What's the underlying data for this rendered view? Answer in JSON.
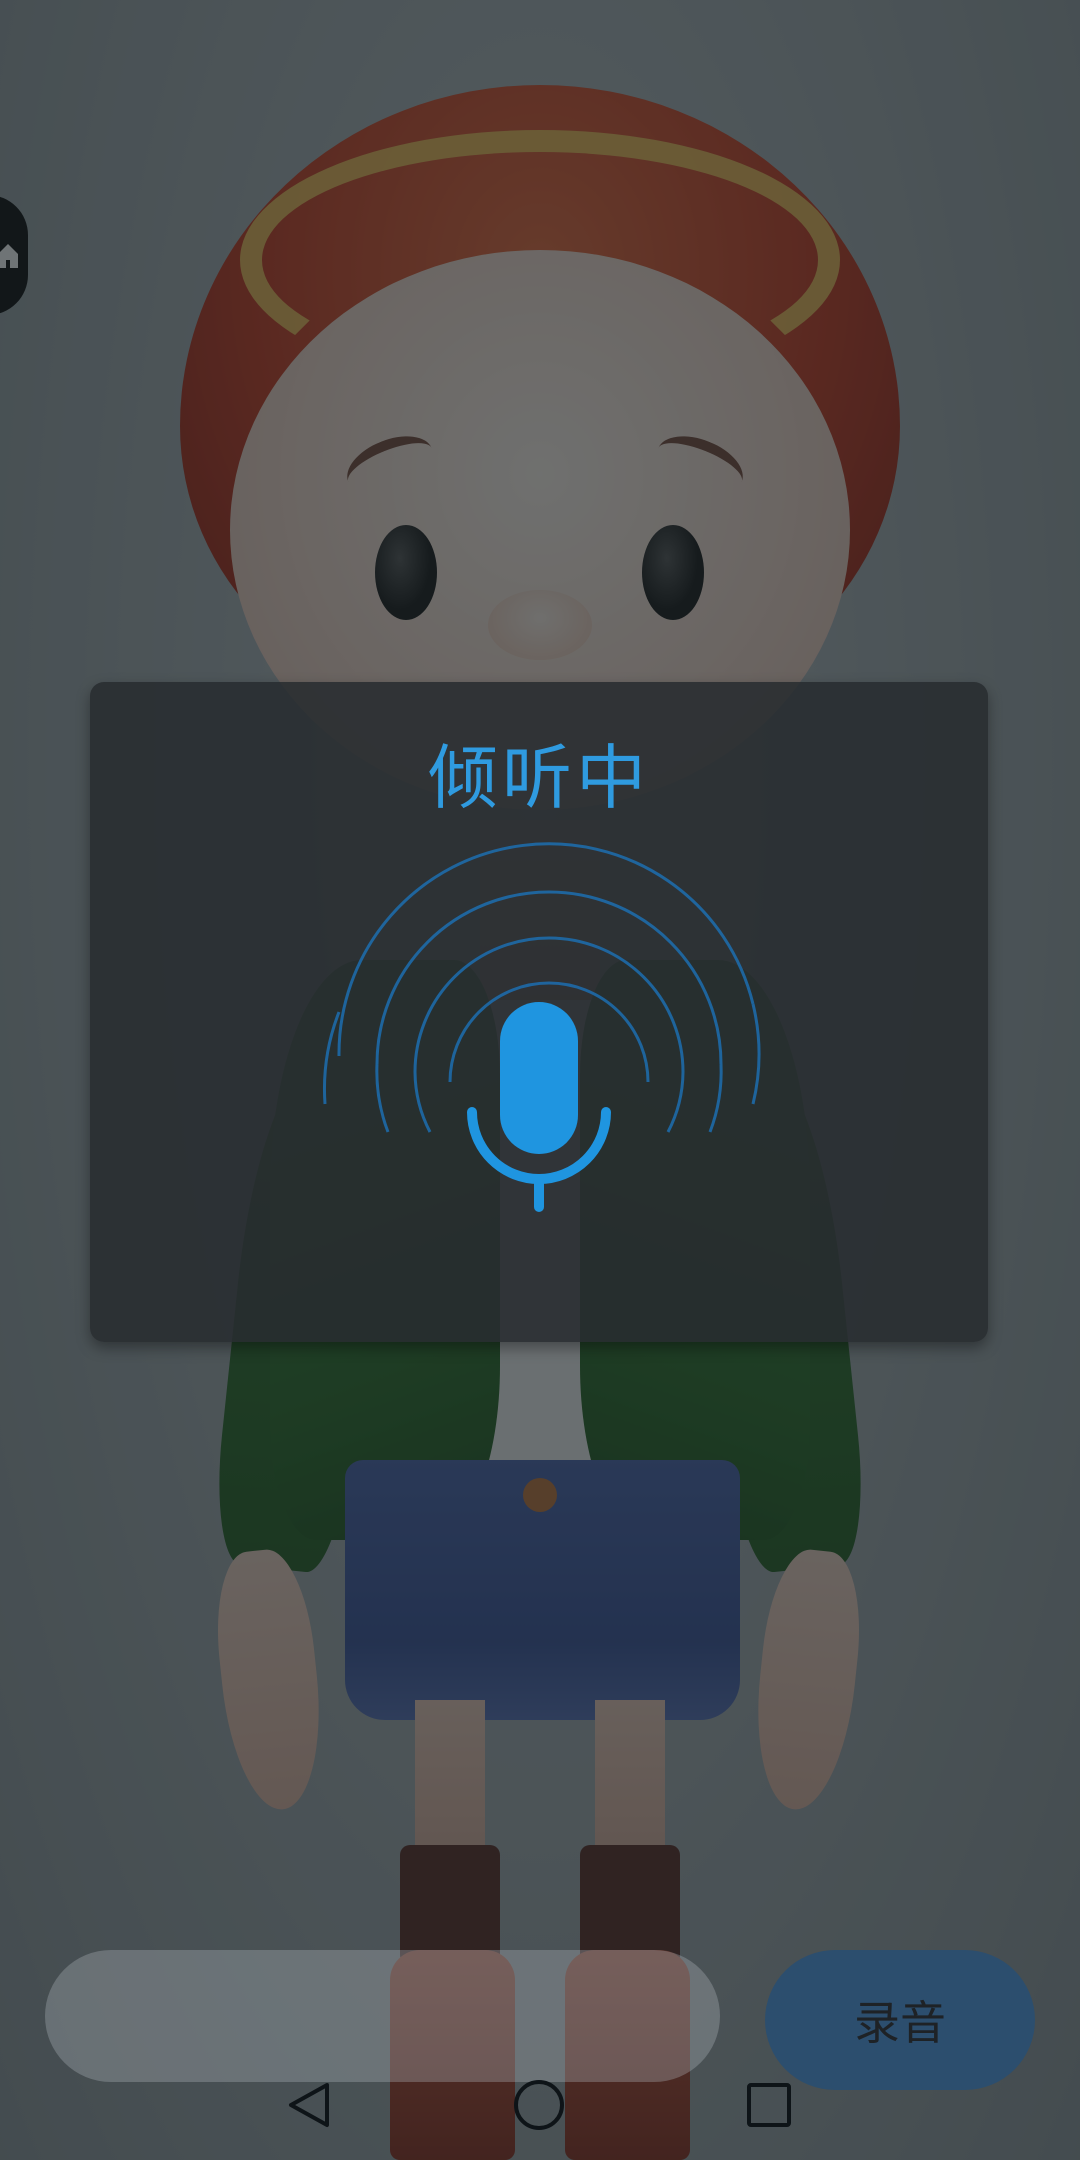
{
  "dialog": {
    "title": "倾听中",
    "icon": "microphone-icon",
    "accent_color": "#2f9be0"
  },
  "input": {
    "value": "",
    "placeholder": ""
  },
  "record_button": {
    "label": "录音",
    "color": "#2c4e6e"
  },
  "nav": {
    "back_icon": "back-triangle-icon",
    "home_icon": "home-circle-icon",
    "recents_icon": "recents-square-icon"
  },
  "floating_widget": {
    "icon": "home-icon"
  }
}
